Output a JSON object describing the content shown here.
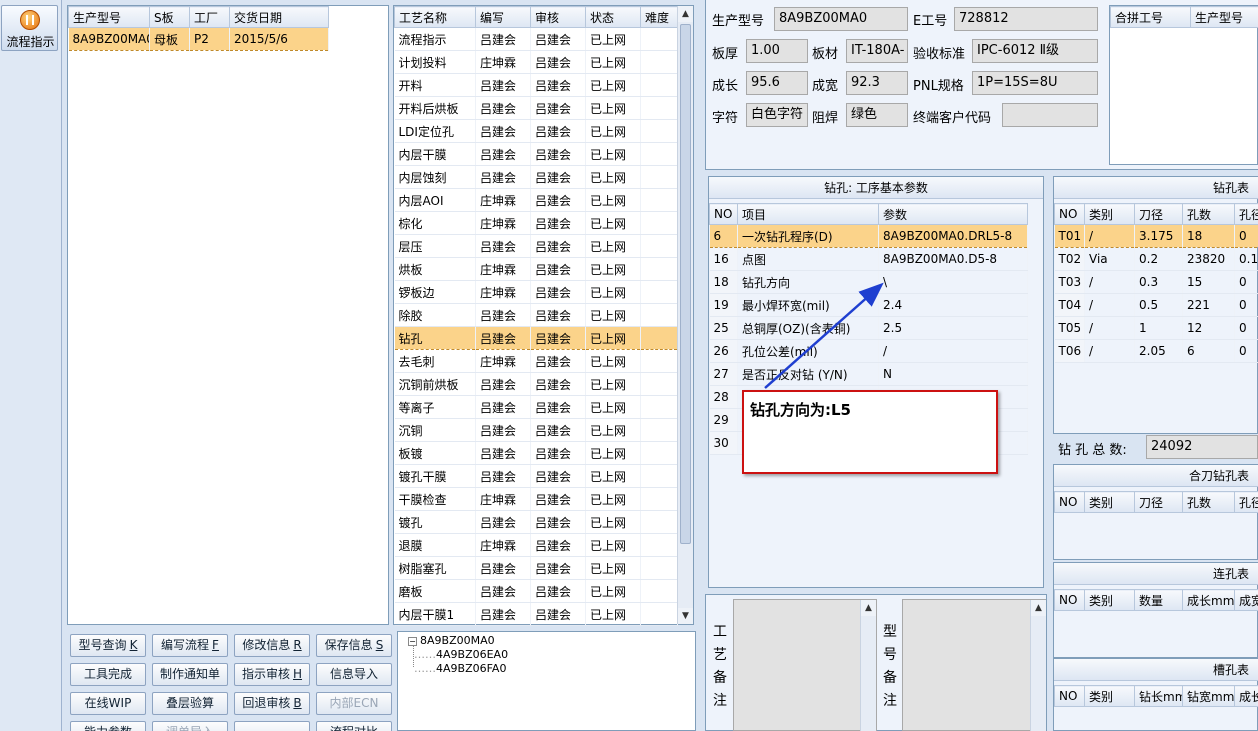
{
  "flow_button": {
    "label": "流程指示"
  },
  "product_table": {
    "headers": [
      "生产型号",
      "S板",
      "工厂",
      "交货日期"
    ],
    "rows": [
      [
        "8A9BZ00MA0",
        "母板",
        "P2",
        "2015/5/6"
      ]
    ]
  },
  "process_table": {
    "headers": [
      "工艺名称",
      "编写",
      "审核",
      "状态",
      "难度"
    ],
    "rows": [
      [
        "流程指示",
        "吕建会",
        "吕建会",
        "已上网",
        ""
      ],
      [
        "计划投料",
        "庄坤霖",
        "吕建会",
        "已上网",
        ""
      ],
      [
        "开料",
        "吕建会",
        "吕建会",
        "已上网",
        ""
      ],
      [
        "开料后烘板",
        "吕建会",
        "吕建会",
        "已上网",
        ""
      ],
      [
        "LDI定位孔",
        "吕建会",
        "吕建会",
        "已上网",
        ""
      ],
      [
        "内层干膜",
        "吕建会",
        "吕建会",
        "已上网",
        ""
      ],
      [
        "内层蚀刻",
        "吕建会",
        "吕建会",
        "已上网",
        ""
      ],
      [
        "内层AOI",
        "庄坤霖",
        "吕建会",
        "已上网",
        ""
      ],
      [
        "棕化",
        "庄坤霖",
        "吕建会",
        "已上网",
        ""
      ],
      [
        "层压",
        "吕建会",
        "吕建会",
        "已上网",
        ""
      ],
      [
        "烘板",
        "庄坤霖",
        "吕建会",
        "已上网",
        ""
      ],
      [
        "锣板边",
        "庄坤霖",
        "吕建会",
        "已上网",
        ""
      ],
      [
        "除胶",
        "吕建会",
        "吕建会",
        "已上网",
        ""
      ],
      [
        "钻孔",
        "吕建会",
        "吕建会",
        "已上网",
        ""
      ],
      [
        "去毛刺",
        "庄坤霖",
        "吕建会",
        "已上网",
        ""
      ],
      [
        "沉铜前烘板",
        "吕建会",
        "吕建会",
        "已上网",
        ""
      ],
      [
        "等离子",
        "吕建会",
        "吕建会",
        "已上网",
        ""
      ],
      [
        "沉铜",
        "吕建会",
        "吕建会",
        "已上网",
        ""
      ],
      [
        "板镀",
        "吕建会",
        "吕建会",
        "已上网",
        ""
      ],
      [
        "镀孔干膜",
        "吕建会",
        "吕建会",
        "已上网",
        ""
      ],
      [
        "干膜检查",
        "庄坤霖",
        "吕建会",
        "已上网",
        ""
      ],
      [
        "镀孔",
        "吕建会",
        "吕建会",
        "已上网",
        ""
      ],
      [
        "退膜",
        "庄坤霖",
        "吕建会",
        "已上网",
        ""
      ],
      [
        "树脂塞孔",
        "吕建会",
        "吕建会",
        "已上网",
        ""
      ],
      [
        "磨板",
        "吕建会",
        "吕建会",
        "已上网",
        ""
      ],
      [
        "内层干膜1",
        "吕建会",
        "吕建会",
        "已上网",
        ""
      ]
    ],
    "selected_index": 13
  },
  "buttons": {
    "row1": [
      {
        "text": "型号查询",
        "key": "K"
      },
      {
        "text": "编写流程",
        "key": "F"
      },
      {
        "text": "修改信息",
        "key": "R"
      },
      {
        "text": "保存信息",
        "key": "S"
      }
    ],
    "row2": [
      {
        "text": "工具完成",
        "key": ""
      },
      {
        "text": "制作通知单",
        "key": ""
      },
      {
        "text": "指示审核",
        "key": "H"
      },
      {
        "text": "信息导入",
        "key": ""
      }
    ],
    "row3": [
      {
        "text": "在线WIP",
        "key": ""
      },
      {
        "text": "叠层验算",
        "key": ""
      },
      {
        "text": "回退审核",
        "key": "B"
      },
      {
        "text": "内部ECN",
        "key": ""
      }
    ],
    "row4": [
      {
        "text": "能力参数",
        "key": ""
      },
      {
        "text": "调单导入",
        "key": ""
      },
      {
        "text": "",
        "key": ""
      },
      {
        "text": "流程对比",
        "key": ""
      }
    ]
  },
  "tree": {
    "root": "8A9BZ00MA0",
    "children": [
      "4A9BZ06EA0",
      "4A9BZ06FA0"
    ]
  },
  "info": {
    "prod_label": "生产型号",
    "prod_value": "8A9BZ00MA0",
    "e_label": "E工号",
    "e_value": "728812",
    "thick_label": "板厚",
    "thick_value": "1.00",
    "mat_label": "板材",
    "mat_value": "IT-180A-",
    "acc_label": "验收标准",
    "acc_value": "IPC-6012 Ⅱ级",
    "len_label": "成长",
    "len_value": "95.6",
    "wid_label": "成宽",
    "wid_value": "92.3",
    "pnl_label": "PNL规格",
    "pnl_value": "1P=15S=8U",
    "char_label": "字符",
    "char_value": "白色字符",
    "mask_label": "阻焊",
    "mask_value": "绿色",
    "cust_label": "终端客户代码",
    "cust_value": ""
  },
  "merge_table": {
    "headers": [
      "合拼工号",
      "生产型号"
    ]
  },
  "drill_params": {
    "title": "钻孔: 工序基本参数",
    "headers": [
      "NO",
      "项目",
      "参数"
    ],
    "rows": [
      [
        "6",
        "一次钻孔程序(D)",
        "8A9BZ00MA0.DRL5-8"
      ],
      [
        "16",
        "点图",
        "8A9BZ00MA0.D5-8"
      ],
      [
        "18",
        "钻孔方向",
        "\\"
      ],
      [
        "19",
        "最小焊环宽(mil)",
        "2.4"
      ],
      [
        "25",
        "总铜厚(OZ)(含表铜)",
        "2.5"
      ],
      [
        "26",
        "孔位公差(mil)",
        "/"
      ],
      [
        "27",
        "是否正反对钻 (Y/N)",
        "N"
      ],
      [
        "28",
        "",
        ""
      ],
      [
        "29",
        "",
        ""
      ],
      [
        "30",
        "",
        ""
      ]
    ],
    "selected_index": 0
  },
  "callout": {
    "text": "钻孔方向为:L5"
  },
  "drill_table": {
    "title": "钻孔表",
    "headers": [
      "NO",
      "类别",
      "刀径",
      "孔数",
      "孔径"
    ],
    "rows": [
      [
        "T01",
        "/",
        "3.175",
        "18",
        "0"
      ],
      [
        "T02",
        "Via",
        "0.2",
        "23820",
        "0.1"
      ],
      [
        "T03",
        "/",
        "0.3",
        "15",
        "0"
      ],
      [
        "T04",
        "/",
        "0.5",
        "221",
        "0"
      ],
      [
        "T05",
        "/",
        "1",
        "12",
        "0"
      ],
      [
        "T06",
        "/",
        "2.05",
        "6",
        "0"
      ]
    ],
    "selected_index": 0
  },
  "total": {
    "label": "钻 孔 总 数:",
    "value": "24092"
  },
  "combo_table": {
    "title": "合刀钻孔表",
    "headers": [
      "NO",
      "类别",
      "刀径",
      "孔数",
      "孔径"
    ]
  },
  "slot_table": {
    "title": "连孔表",
    "headers": [
      "NO",
      "类别",
      "数量",
      "成长mm",
      "成宽"
    ]
  },
  "groove_table": {
    "title": "槽孔表",
    "headers": [
      "NO",
      "类别",
      "钻长mm",
      "钻宽mm",
      "成长"
    ]
  },
  "remark": {
    "process_label": [
      "工",
      "艺",
      "备",
      "注"
    ],
    "model_label": [
      "型",
      "号",
      "备",
      "注"
    ]
  },
  "colors": {
    "selected_row": "#fbd38a",
    "callout_border": "#cc1111",
    "arrow": "#1f3fd0"
  }
}
